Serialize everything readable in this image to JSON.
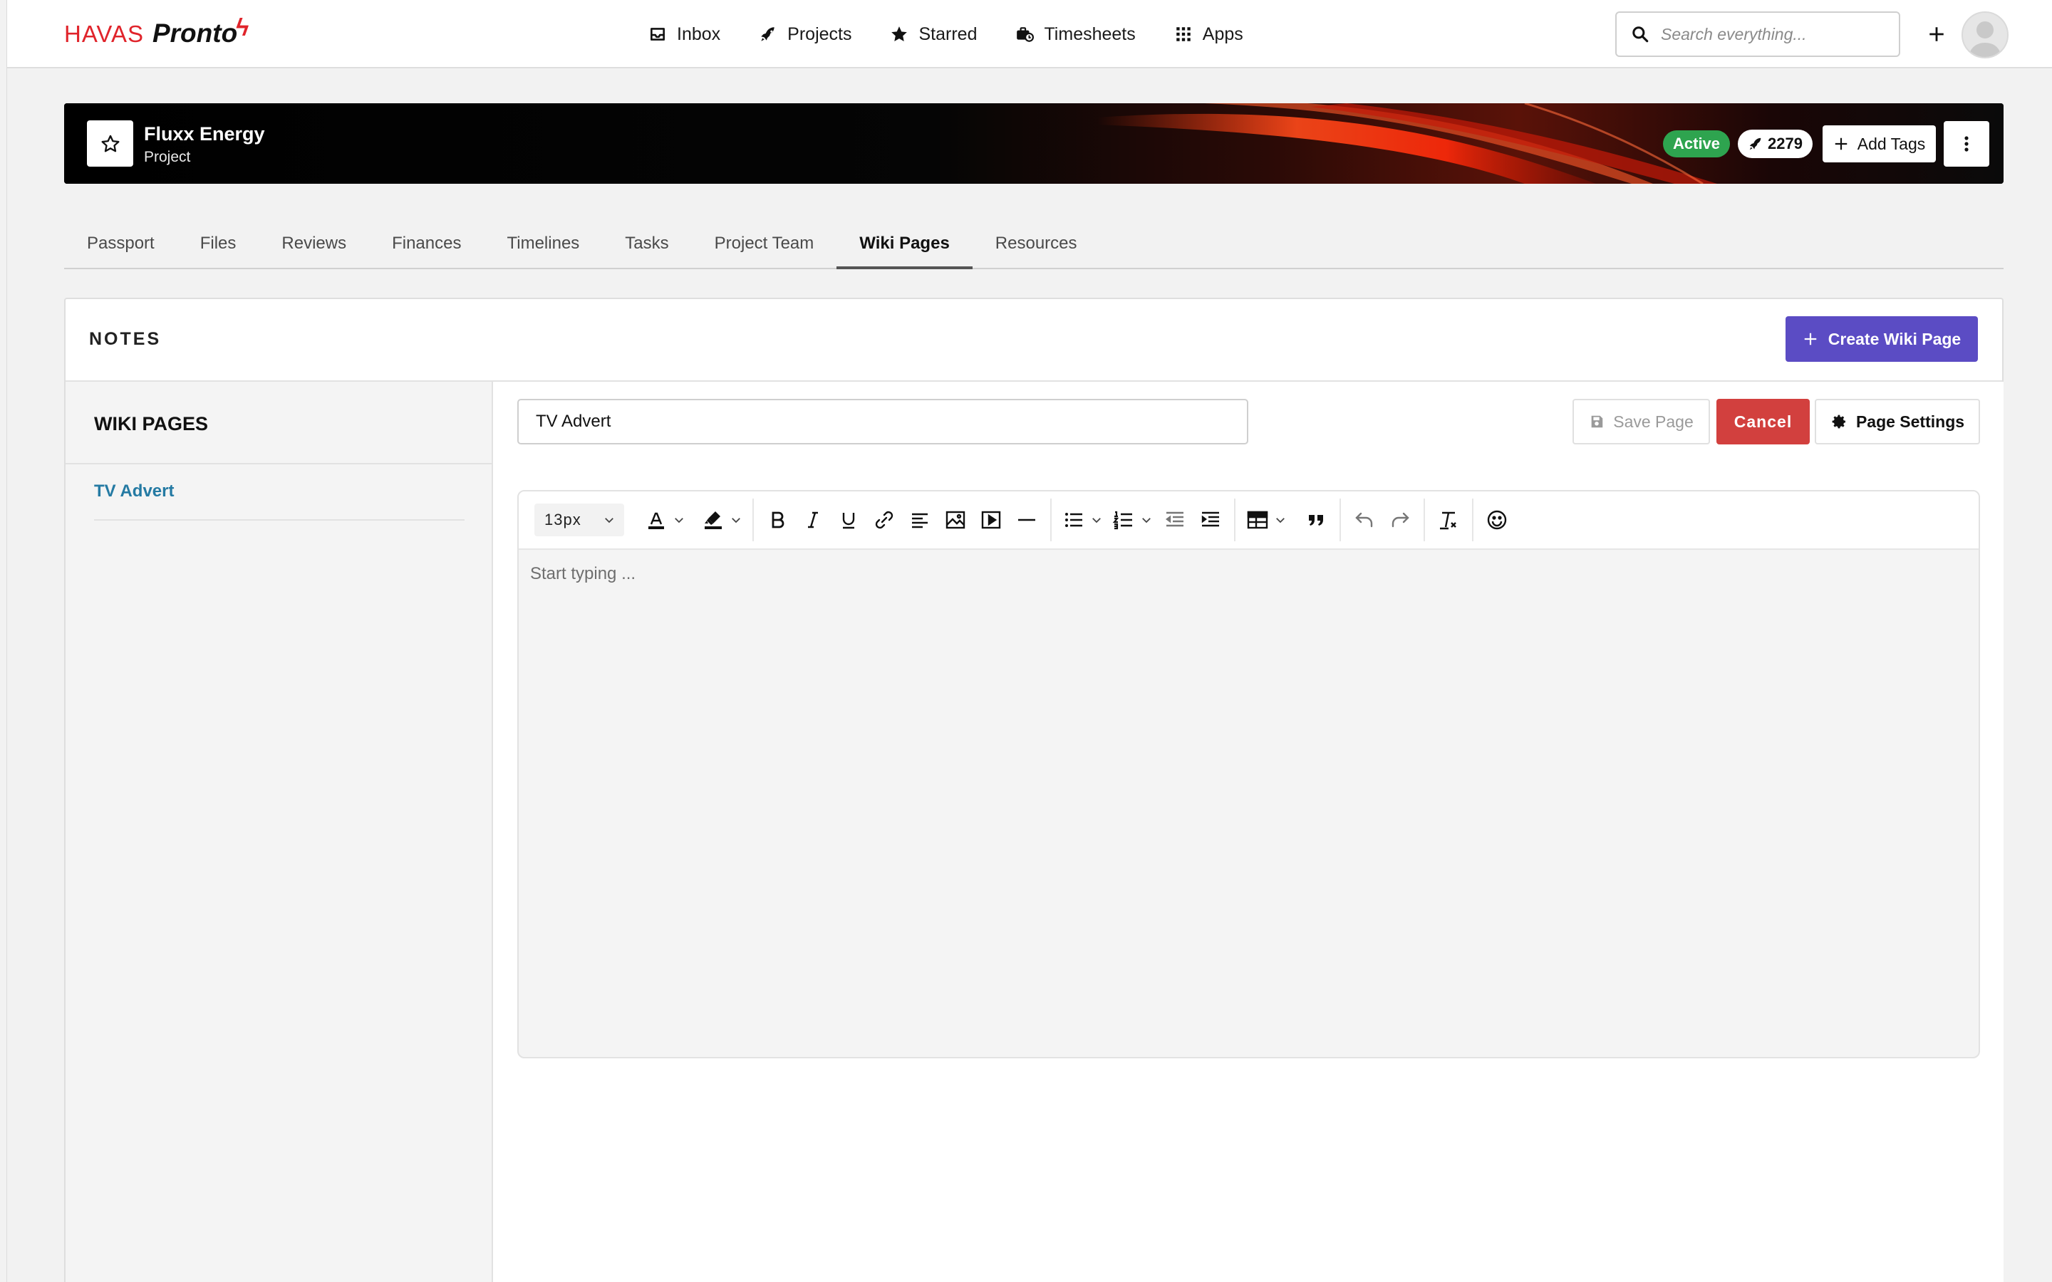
{
  "brand": {
    "primary": "HAVAS",
    "secondary": "Pronto",
    "accent_color": "#e0242b"
  },
  "nav": {
    "items": [
      {
        "label": "Inbox",
        "icon": "inbox-icon"
      },
      {
        "label": "Projects",
        "icon": "rocket-icon"
      },
      {
        "label": "Starred",
        "icon": "star-icon"
      },
      {
        "label": "Timesheets",
        "icon": "timesheets-icon"
      },
      {
        "label": "Apps",
        "icon": "grid-icon"
      }
    ],
    "search_placeholder": "Search everything..."
  },
  "project": {
    "title": "Fluxx Energy",
    "subtitle": "Project",
    "status": "Active",
    "status_color": "#2ea44f",
    "count": "2279",
    "add_tags_label": "Add Tags"
  },
  "tabs": [
    {
      "label": "Passport"
    },
    {
      "label": "Files"
    },
    {
      "label": "Reviews"
    },
    {
      "label": "Finances"
    },
    {
      "label": "Timelines"
    },
    {
      "label": "Tasks"
    },
    {
      "label": "Project Team"
    },
    {
      "label": "Wiki Pages",
      "active": true
    },
    {
      "label": "Resources"
    }
  ],
  "notes": {
    "title": "NOTES",
    "create_label": "Create Wiki Page",
    "create_color": "#5b4cc4"
  },
  "wiki_sidebar": {
    "title": "WIKI PAGES",
    "pages": [
      {
        "label": "TV Advert"
      }
    ]
  },
  "editor": {
    "page_title_value": "TV Advert",
    "save_label": "Save Page",
    "cancel_label": "Cancel",
    "cancel_color": "#d2403e",
    "settings_label": "Page Settings",
    "font_size": "13px",
    "body_placeholder": "Start typing ..."
  }
}
